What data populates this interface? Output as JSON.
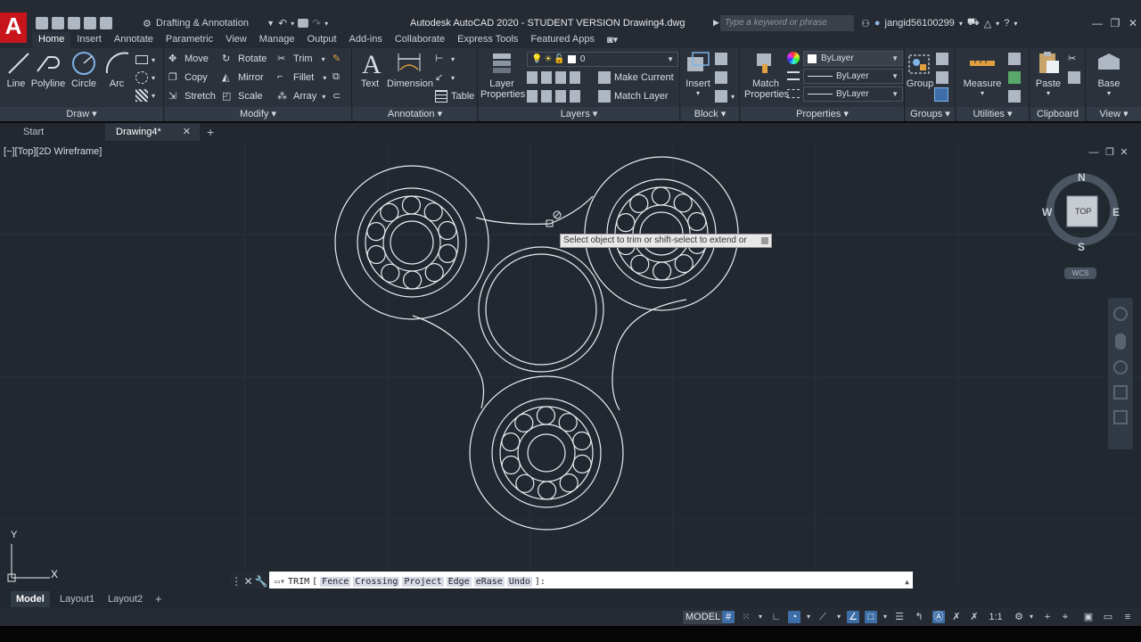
{
  "app": {
    "logo_letter": "A",
    "window_title": "Autodesk AutoCAD 2020 - STUDENT VERSION    Drawing4.dwg",
    "workspace": "Drafting & Annotation",
    "search_placeholder": "Type a keyword or phrase",
    "username": "jangid56100299"
  },
  "ribbon_tabs": [
    "Home",
    "Insert",
    "Annotate",
    "Parametric",
    "View",
    "Manage",
    "Output",
    "Add-ins",
    "Collaborate",
    "Express Tools",
    "Featured Apps"
  ],
  "panels": {
    "draw": {
      "title": "Draw",
      "line": "Line",
      "polyline": "Polyline",
      "circle": "Circle",
      "arc": "Arc"
    },
    "modify": {
      "title": "Modify",
      "move": "Move",
      "rotate": "Rotate",
      "trim": "Trim",
      "copy": "Copy",
      "mirror": "Mirror",
      "fillet": "Fillet",
      "stretch": "Stretch",
      "scale": "Scale",
      "array": "Array"
    },
    "annotation": {
      "title": "Annotation",
      "text": "Text",
      "dimension": "Dimension",
      "table": "Table"
    },
    "layers": {
      "title": "Layers",
      "layer_properties_1": "Layer",
      "layer_properties_2": "Properties",
      "current_layer": "0",
      "make_current": "Make Current",
      "match_layer": "Match Layer"
    },
    "block": {
      "title": "Block",
      "insert": "Insert"
    },
    "properties": {
      "title": "Properties",
      "match_1": "Match",
      "match_2": "Properties",
      "color": "ByLayer",
      "linetype": "ByLayer",
      "lineweight": "ByLayer"
    },
    "groups": {
      "title": "Groups",
      "group": "Group"
    },
    "utilities": {
      "title": "Utilities",
      "measure": "Measure"
    },
    "clipboard": {
      "title": "Clipboard",
      "paste": "Paste"
    },
    "view": {
      "title": "View",
      "base": "Base"
    }
  },
  "file_tabs": {
    "start": "Start",
    "drawing": "Drawing4*"
  },
  "viewport": {
    "label": "[−][Top][2D Wireframe]",
    "tooltip": "Select object to trim or shift-select to extend or",
    "compass": {
      "n": "N",
      "s": "S",
      "e": "E",
      "w": "W",
      "top": "TOP",
      "wcs": "WCS"
    },
    "ucs": {
      "x": "X",
      "y": "Y"
    }
  },
  "command_line": {
    "command": "TRIM",
    "options": [
      "Fence",
      "Crossing",
      "Project",
      "Edge",
      "eRase",
      "Undo"
    ],
    "open_bracket": "[",
    "close_bracket": "]:"
  },
  "layout_tabs": [
    "Model",
    "Layout1",
    "Layout2"
  ],
  "status": {
    "model": "MODEL",
    "scale": "1:1"
  },
  "colors": {
    "canvas": "#212830",
    "ribbon": "#2b323c",
    "accent": "#3d6ea8",
    "logo": "#c8151b"
  }
}
